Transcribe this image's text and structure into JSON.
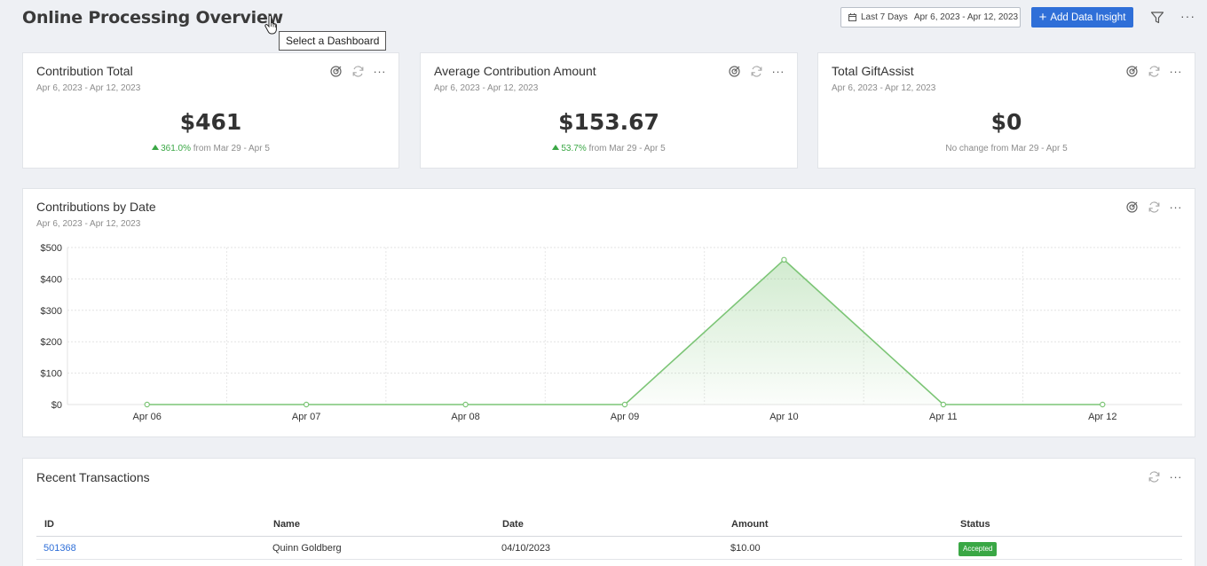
{
  "header": {
    "title": "Online Processing Overview",
    "tooltip": "Select a Dashboard",
    "date_preset": "Last 7 Days",
    "date_range": "Apr 6, 2023 - Apr 12, 2023",
    "add_button": "Add Data Insight",
    "more": "···"
  },
  "kpis": [
    {
      "title": "Contribution Total",
      "range": "Apr 6, 2023 - Apr 12, 2023",
      "value": "$461",
      "change": "361.0%",
      "change_text": " from Mar 29 - Apr 5"
    },
    {
      "title": "Average Contribution Amount",
      "range": "Apr 6, 2023 - Apr 12, 2023",
      "value": "$153.67",
      "change": "53.7%",
      "change_text": " from Mar 29 - Apr 5"
    },
    {
      "title": "Total GiftAssist",
      "range": "Apr 6, 2023 - Apr 12, 2023",
      "value": "$0",
      "change": "",
      "change_text": "No change from Mar 29 - Apr 5"
    }
  ],
  "chart_card": {
    "title": "Contributions by Date",
    "range": "Apr 6, 2023 - Apr 12, 2023"
  },
  "chart_data": {
    "type": "area",
    "title": "Contributions by Date",
    "categories": [
      "Apr 06",
      "Apr 07",
      "Apr 08",
      "Apr 09",
      "Apr 10",
      "Apr 11",
      "Apr 12"
    ],
    "values": [
      0,
      0,
      0,
      0,
      461,
      0,
      0
    ],
    "ylim": [
      0,
      500
    ],
    "yticks": [
      0,
      100,
      200,
      300,
      400,
      500
    ],
    "ytick_labels": [
      "$0",
      "$100",
      "$200",
      "$300",
      "$400",
      "$500"
    ],
    "color": "#7cc576",
    "grid": true
  },
  "transactions": {
    "title": "Recent Transactions",
    "columns": [
      "ID",
      "Name",
      "Date",
      "Amount",
      "Status"
    ],
    "rows": [
      {
        "id": "501368",
        "name": "Quinn Goldberg",
        "date": "04/10/2023",
        "amount": "$10.00",
        "status": "Accepted"
      }
    ]
  },
  "colors": {
    "accent": "#2f6fd8",
    "success": "#3aa745",
    "chart_line": "#7cc576"
  }
}
